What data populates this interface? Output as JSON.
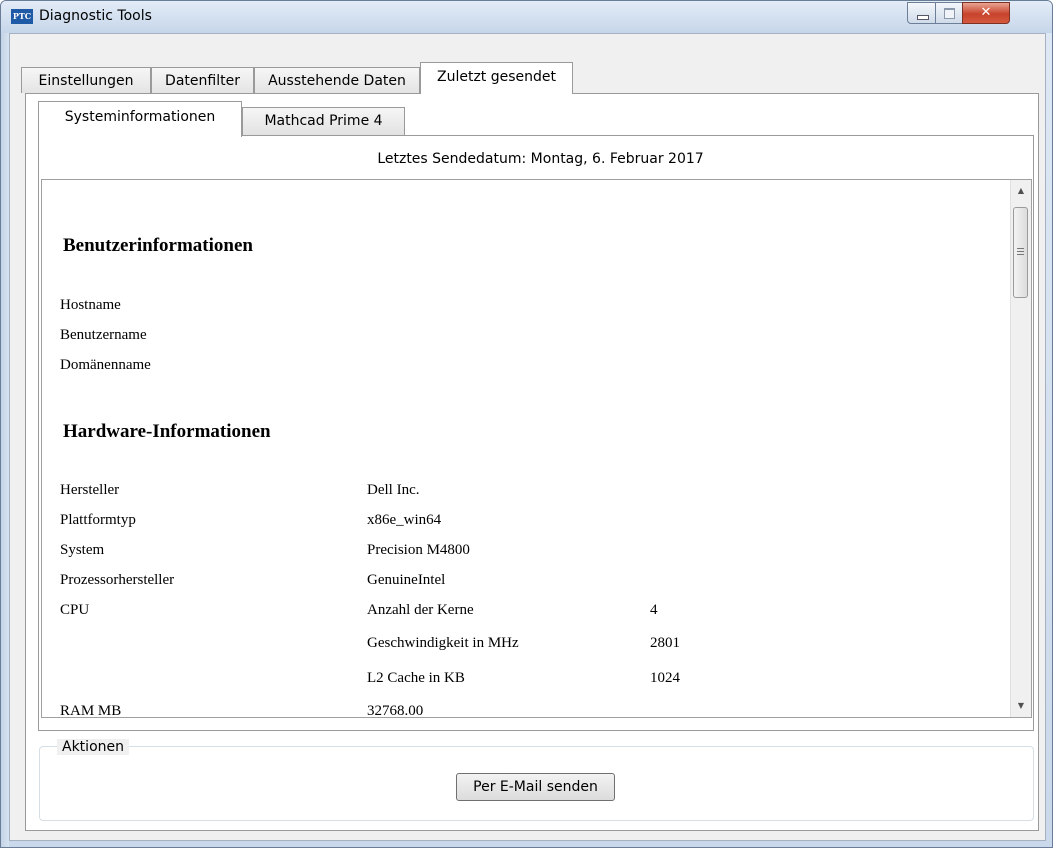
{
  "window": {
    "title": "Diagnostic Tools",
    "icon": "ptc-logo-icon",
    "icon_text": "PTC"
  },
  "outer_tabs": [
    {
      "label": "Einstellungen",
      "active": false
    },
    {
      "label": "Datenfilter",
      "active": false
    },
    {
      "label": "Ausstehende Daten",
      "active": false
    },
    {
      "label": "Zuletzt gesendet",
      "active": true
    }
  ],
  "inner_tabs": [
    {
      "label": "Systeminformationen",
      "active": true
    },
    {
      "label": "Mathcad Prime 4",
      "active": false
    }
  ],
  "last_sent": "Letztes Sendedatum: Montag, 6. Februar 2017",
  "report": {
    "user_section": {
      "heading": "Benutzerinformationen",
      "fields": [
        "Hostname",
        "Benutzername",
        "Domänenname"
      ]
    },
    "hardware_section": {
      "heading": "Hardware-Informationen",
      "rows": [
        {
          "label": "Hersteller",
          "value": "Dell Inc."
        },
        {
          "label": "Plattformtyp",
          "value": "x86e_win64"
        },
        {
          "label": "System",
          "value": "Precision M4800"
        },
        {
          "label": "Prozessorhersteller",
          "value": "GenuineIntel"
        }
      ],
      "cpu": {
        "label": "CPU",
        "rows": [
          {
            "name": "Anzahl der Kerne",
            "value": "4"
          },
          {
            "name": "Geschwindigkeit in MHz",
            "value": "2801"
          },
          {
            "name": "L2 Cache in KB",
            "value": "1024"
          }
        ]
      },
      "ram": {
        "label": "RAM MB",
        "value": "32768.00"
      }
    }
  },
  "actions": {
    "legend": "Aktionen",
    "email_button": "Per E-Mail senden"
  },
  "colors": {
    "title_bar": "#c9d8ea",
    "close_button": "#c7432b",
    "panel_bg": "#f0f0f0"
  }
}
